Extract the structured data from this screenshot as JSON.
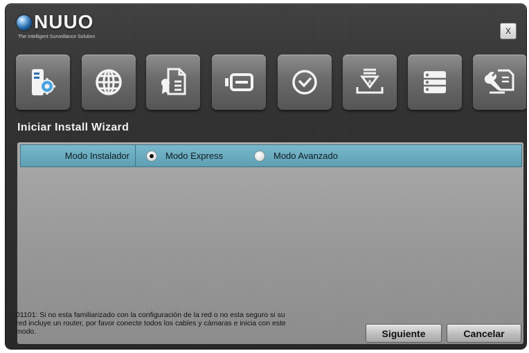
{
  "header": {
    "logo_text": "NUUO",
    "tagline": "The Intelligent Surveillance Solution",
    "close_label": "X"
  },
  "toolbar": {
    "items": [
      {
        "icon": "server-settings-icon"
      },
      {
        "icon": "globe-icon"
      },
      {
        "icon": "license-certificate-icon"
      },
      {
        "icon": "device-card-icon"
      },
      {
        "icon": "clock-icon"
      },
      {
        "icon": "download-install-icon"
      },
      {
        "icon": "storage-list-icon"
      },
      {
        "icon": "tools-document-icon"
      }
    ]
  },
  "wizard": {
    "title": "Iniciar Install Wizard",
    "mode_label": "Modo Instalador",
    "options": [
      {
        "label": "Modo Express",
        "checked": true
      },
      {
        "label": "Modo Avanzado",
        "checked": false
      }
    ],
    "note": "01101: Si no esta familiarizado con la configuración de la red o no esta seguro si su red incluye un router,  por favor conecte todos los cables y cámaras e inicia con este modo.",
    "next_label": "Siguiente",
    "cancel_label": "Cancelar"
  },
  "colors": {
    "accent_row": "#6aaec2",
    "window_bg": "#2e2e2e",
    "panel_bg": "#9c9c9c"
  }
}
